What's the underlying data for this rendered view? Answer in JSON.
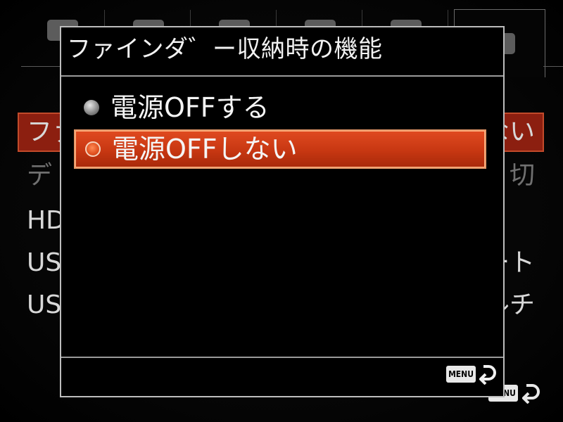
{
  "background_menu": {
    "tabs": [
      {
        "icon": "camera-icon",
        "active": false
      },
      {
        "icon": "custom-icon",
        "active": false
      },
      {
        "icon": "wireless-icon",
        "active": false
      },
      {
        "icon": "playback-icon",
        "active": false
      },
      {
        "icon": "application-icon",
        "active": false
      },
      {
        "icon": "setup-toolbox-icon",
        "active": true
      }
    ],
    "items": [
      {
        "label": "ファイ",
        "value": "ない"
      },
      {
        "label": "デ",
        "value": "切"
      },
      {
        "label": "HDM",
        "value": ""
      },
      {
        "label": "USB",
        "value": "ート"
      },
      {
        "label": "USB",
        "value": "ルチ"
      }
    ],
    "menu_key": "MENU"
  },
  "dialog": {
    "title": "ファインダ゛ー収納時の機能",
    "options": [
      {
        "label": "電源OFFする",
        "selected": false
      },
      {
        "label": "電源OFFしない",
        "selected": true
      }
    ],
    "menu_key": "MENU",
    "back_icon": "return-arrow-icon"
  },
  "colors": {
    "selection": "#c73712",
    "selection_border": "#e89a6a",
    "dialog_border": "#bdbdbd"
  }
}
